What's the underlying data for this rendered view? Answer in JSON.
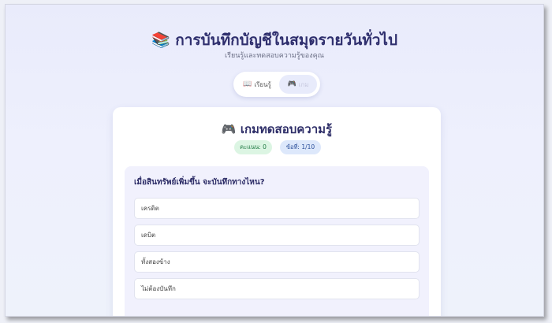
{
  "header": {
    "icon": "books-icon",
    "title": "📚 การบันทึกบัญชีในสมุดรายวันทั่วไป",
    "subtitle": "เรียนรู้และทดสอบความรู้ของคุณ"
  },
  "tabs": [
    {
      "icon": "📖",
      "label": "เรียนรู้",
      "active": false
    },
    {
      "icon": "🎮",
      "label": "เกม",
      "active": true
    }
  ],
  "game": {
    "title": "🎮 เกมทดสอบความรู้",
    "score_label": "คะแนน: 0",
    "question_counter": "ข้อที่: 1/10",
    "question": "เมื่อสินทรัพย์เพิ่มขึ้น จะบันทึกทางไหน?",
    "options": [
      "เครดิต",
      "เดบิต",
      "ทั้งสองข้าง",
      "ไม่ต้องบันทึก"
    ]
  },
  "colors": {
    "title": "#2f2f6e",
    "score_badge_bg": "#dcf5e3",
    "question_badge_bg": "#dde8fb",
    "quiz_panel_bg": "#f1f1fd",
    "active_tab_bg": "#e8ebfb"
  }
}
